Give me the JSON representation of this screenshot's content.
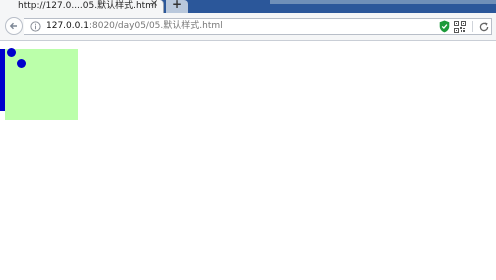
{
  "tab": {
    "title": "http://127.0....05.默认样式.html",
    "close_label": "×",
    "newtab_label": "+"
  },
  "nav": {
    "url_host": "127.0.0.1",
    "url_rest": ":8020/day05/05.默认样式.html"
  },
  "icons": {
    "back": "back-arrow-icon",
    "info": "info-icon",
    "shield": "shield-icon",
    "qr": "qr-code-icon",
    "reload": "reload-icon"
  },
  "colors": {
    "tab_strip": "#2b579a",
    "green_box": "#bbffaa",
    "blue_marks": "#0000cc",
    "shield": "#1c9a3a"
  }
}
